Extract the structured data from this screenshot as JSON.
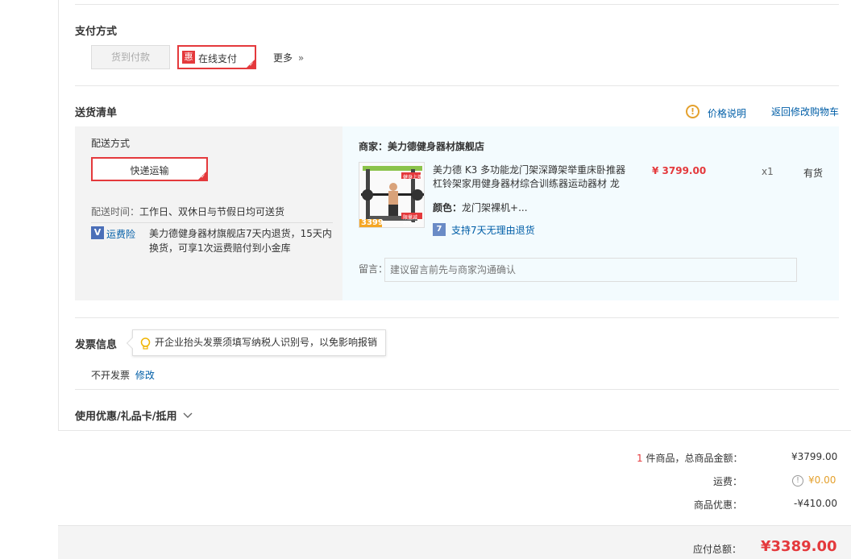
{
  "payment": {
    "title": "支付方式",
    "cod_label": "货到付款",
    "online_badge": "惠",
    "online_label": "在线支付",
    "more_label": "更多",
    "more_arrow": "»"
  },
  "delivery": {
    "title": "送货清单",
    "price_note_label": "价格说明",
    "back_to_cart_label": "返回修改购物车",
    "shipping_method_title": "配送方式",
    "shipping_method_option": "快递运输",
    "delivery_time_label": "配送时间：",
    "delivery_time_value": "工作日、双休日与节假日均可送货",
    "insurance_badge": "V",
    "insurance_label": "运费险",
    "insurance_desc_line1": "美力德健身器材旗舰店7天内退货，15天内",
    "insurance_desc_line2": "换货，可享1次运费赔付到小金库"
  },
  "shop": {
    "label": "商家：美力德健身器材旗舰店"
  },
  "product": {
    "name_line1": "美力德 K3 多功能龙门架深蹲架举重床卧推器",
    "name_line2": "杠铃架家用健身器材综合训练器运动器材 龙",
    "price": "¥ 3799.00",
    "quantity": "x1",
    "stock": "有货",
    "color_label": "颜色：",
    "color_value": "龙门架裸机+...",
    "image_price_tag": "3399",
    "image_promo_tag": "健身上墙",
    "image_coupon_tag": "限量减400",
    "return_badge": "7",
    "return_policy": "支持7天无理由退货"
  },
  "message": {
    "label": "留言：",
    "placeholder": "建议留言前先与商家沟通确认"
  },
  "invoice": {
    "title": "发票信息",
    "tip": "开企业抬头发票须填写纳税人识别号，以免影响报销",
    "status": "不开发票",
    "edit_label": "修改"
  },
  "coupon": {
    "title": "使用优惠/礼品卡/抵用"
  },
  "summary": {
    "item_count": "1",
    "item_count_suffix": "件商品，总商品金额：",
    "goods_total": "¥3799.00",
    "shipping_label": "运费：",
    "shipping_value": "¥0.00",
    "discount_label": "商品优惠：",
    "discount_value": "-¥410.00",
    "payable_label": "应付总额：",
    "payable_value": "¥3389.00"
  },
  "colors": {
    "accent_red": "#e4393c",
    "link_blue": "#005ea7",
    "panel_grey": "#f3f3f3",
    "panel_blue": "#f3fbfe",
    "orange": "#e4a12e"
  }
}
